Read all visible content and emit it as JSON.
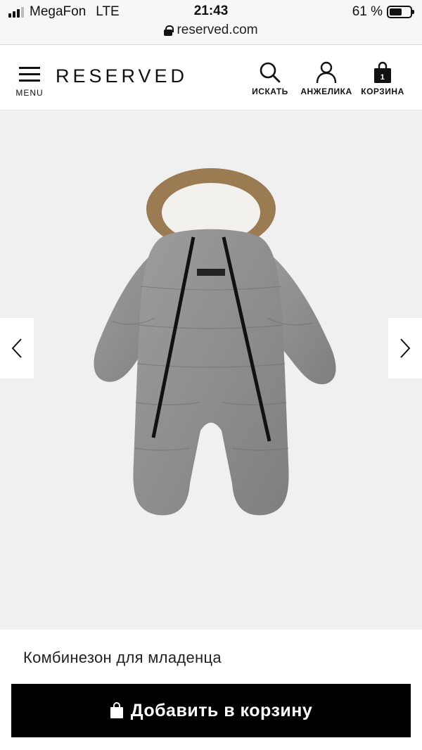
{
  "status_bar": {
    "carrier": "MegaFon",
    "network": "LTE",
    "time": "21:43",
    "battery": "61 %",
    "battery_level": 0.61,
    "url": "reserved.com"
  },
  "header": {
    "menu_label": "MENU",
    "logo": "RESERVED",
    "search_label": "ИСКАТЬ",
    "account_label": "АНЖЕЛИКА",
    "cart_label": "КОРЗИНА",
    "cart_count": "1"
  },
  "gallery": {
    "prev_icon": "chevron-left-icon",
    "next_icon": "chevron-right-icon"
  },
  "product": {
    "title": "Комбинезон для младенца",
    "add_to_cart_label": "Добавить в корзину"
  },
  "colors": {
    "button_bg": "#000000",
    "gallery_bg": "#f0f0f0"
  }
}
